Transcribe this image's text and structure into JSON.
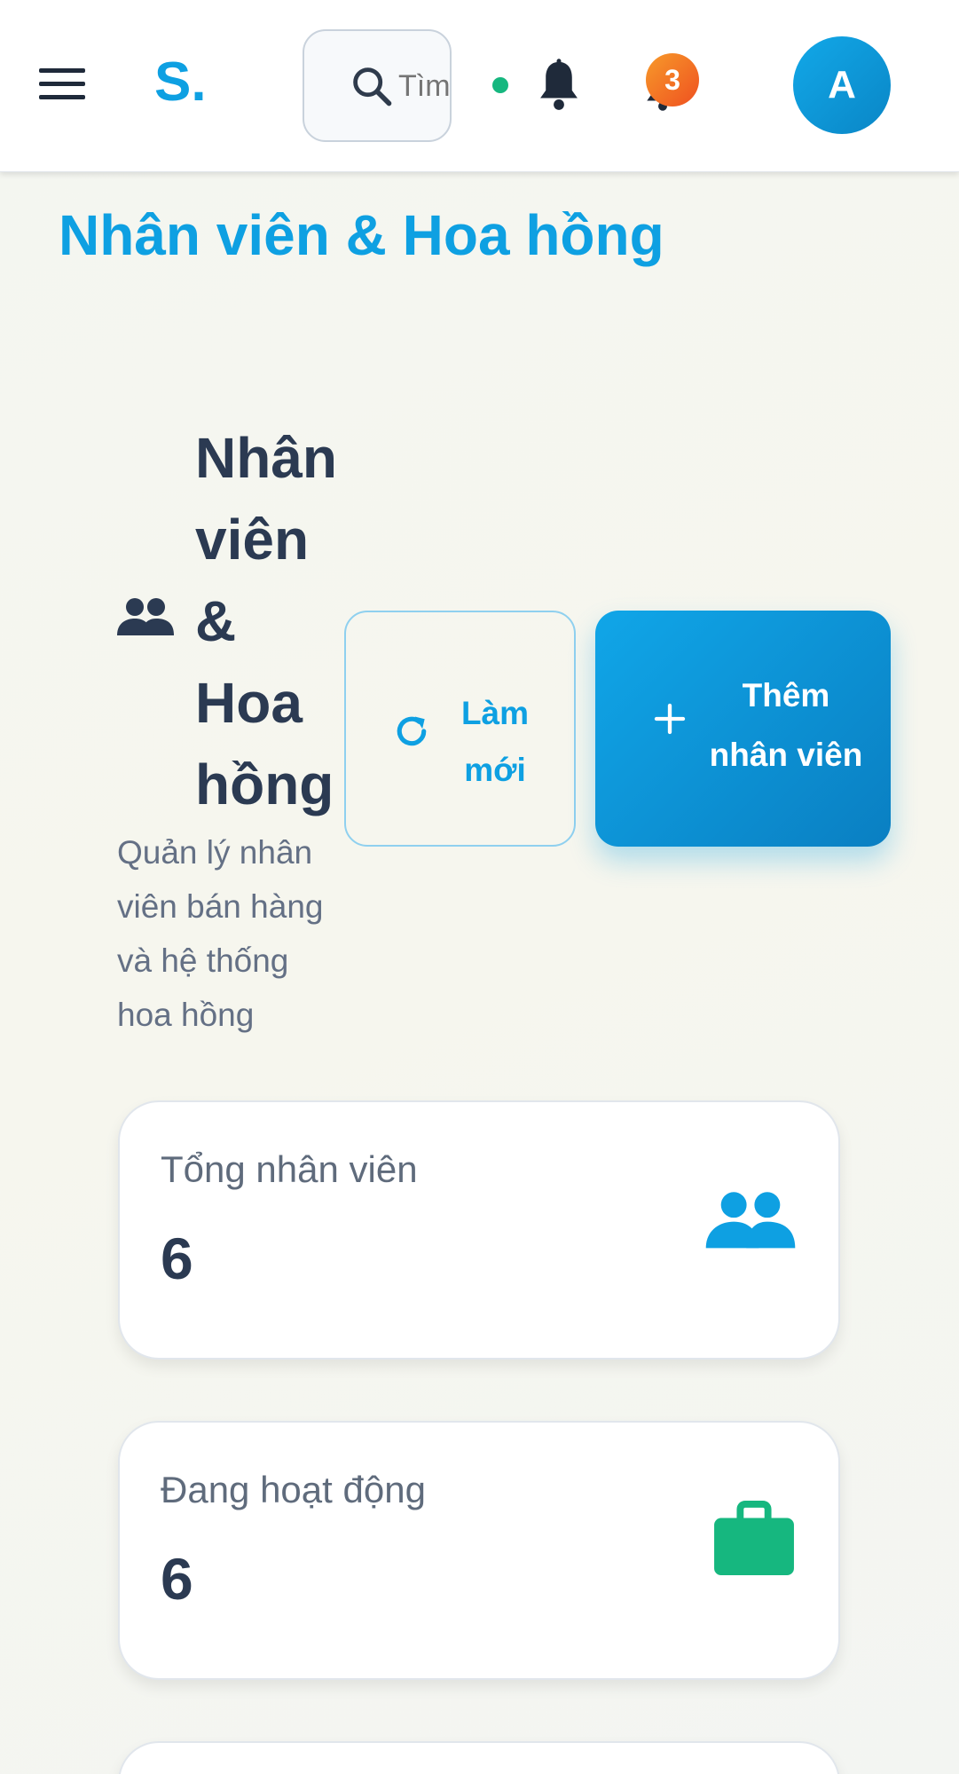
{
  "topbar": {
    "brand": "S.",
    "search_placeholder": "Tìm kiếm...",
    "notification_count": "3",
    "avatar_initial": "A"
  },
  "page": {
    "title": "Nhân viên & Hoa hồng"
  },
  "header": {
    "title": "Nhân viên & Hoa hồng",
    "subtitle": "Quản lý nhân viên bán hàng và hệ thống hoa hồng",
    "refresh_label": "Làm mới",
    "add_label": "Thêm nhân viên"
  },
  "stats": [
    {
      "label": "Tổng nhân viên",
      "value": "6",
      "icon": "users-icon",
      "color": "#0ea0e2"
    },
    {
      "label": "Đang hoạt động",
      "value": "6",
      "icon": "briefcase-icon",
      "color": "#16b77f"
    }
  ],
  "colors": {
    "accent": "#0ea0e2",
    "success": "#16b77f",
    "badge": "#ef5020"
  }
}
